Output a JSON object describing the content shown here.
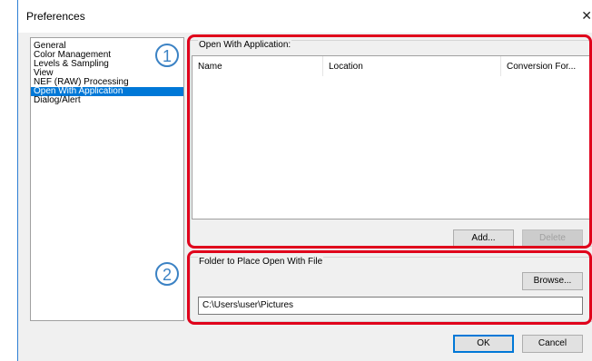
{
  "window": {
    "title": "Preferences",
    "close_glyph": "✕"
  },
  "categories": [
    {
      "label": "General",
      "selected": false
    },
    {
      "label": "Color Management",
      "selected": false
    },
    {
      "label": "Levels & Sampling",
      "selected": false
    },
    {
      "label": "View",
      "selected": false
    },
    {
      "label": "NEF (RAW) Processing",
      "selected": false
    },
    {
      "label": "Open With Application",
      "selected": true
    },
    {
      "label": "Dialog/Alert",
      "selected": false
    }
  ],
  "open_with": {
    "caption": "Open With Application:",
    "columns": [
      "Name",
      "Location",
      "Conversion For..."
    ],
    "add_label": "Add...",
    "delete_label": "Delete"
  },
  "folder": {
    "caption": "Folder to Place Open With File",
    "browse_label": "Browse...",
    "path_value": "C:\\Users\\user\\Pictures"
  },
  "footer": {
    "ok_label": "OK",
    "cancel_label": "Cancel"
  },
  "annotations": {
    "callout_1": "1",
    "callout_2": "2",
    "highlight_color": "#e0001b",
    "callout_color": "#3b82c4"
  }
}
